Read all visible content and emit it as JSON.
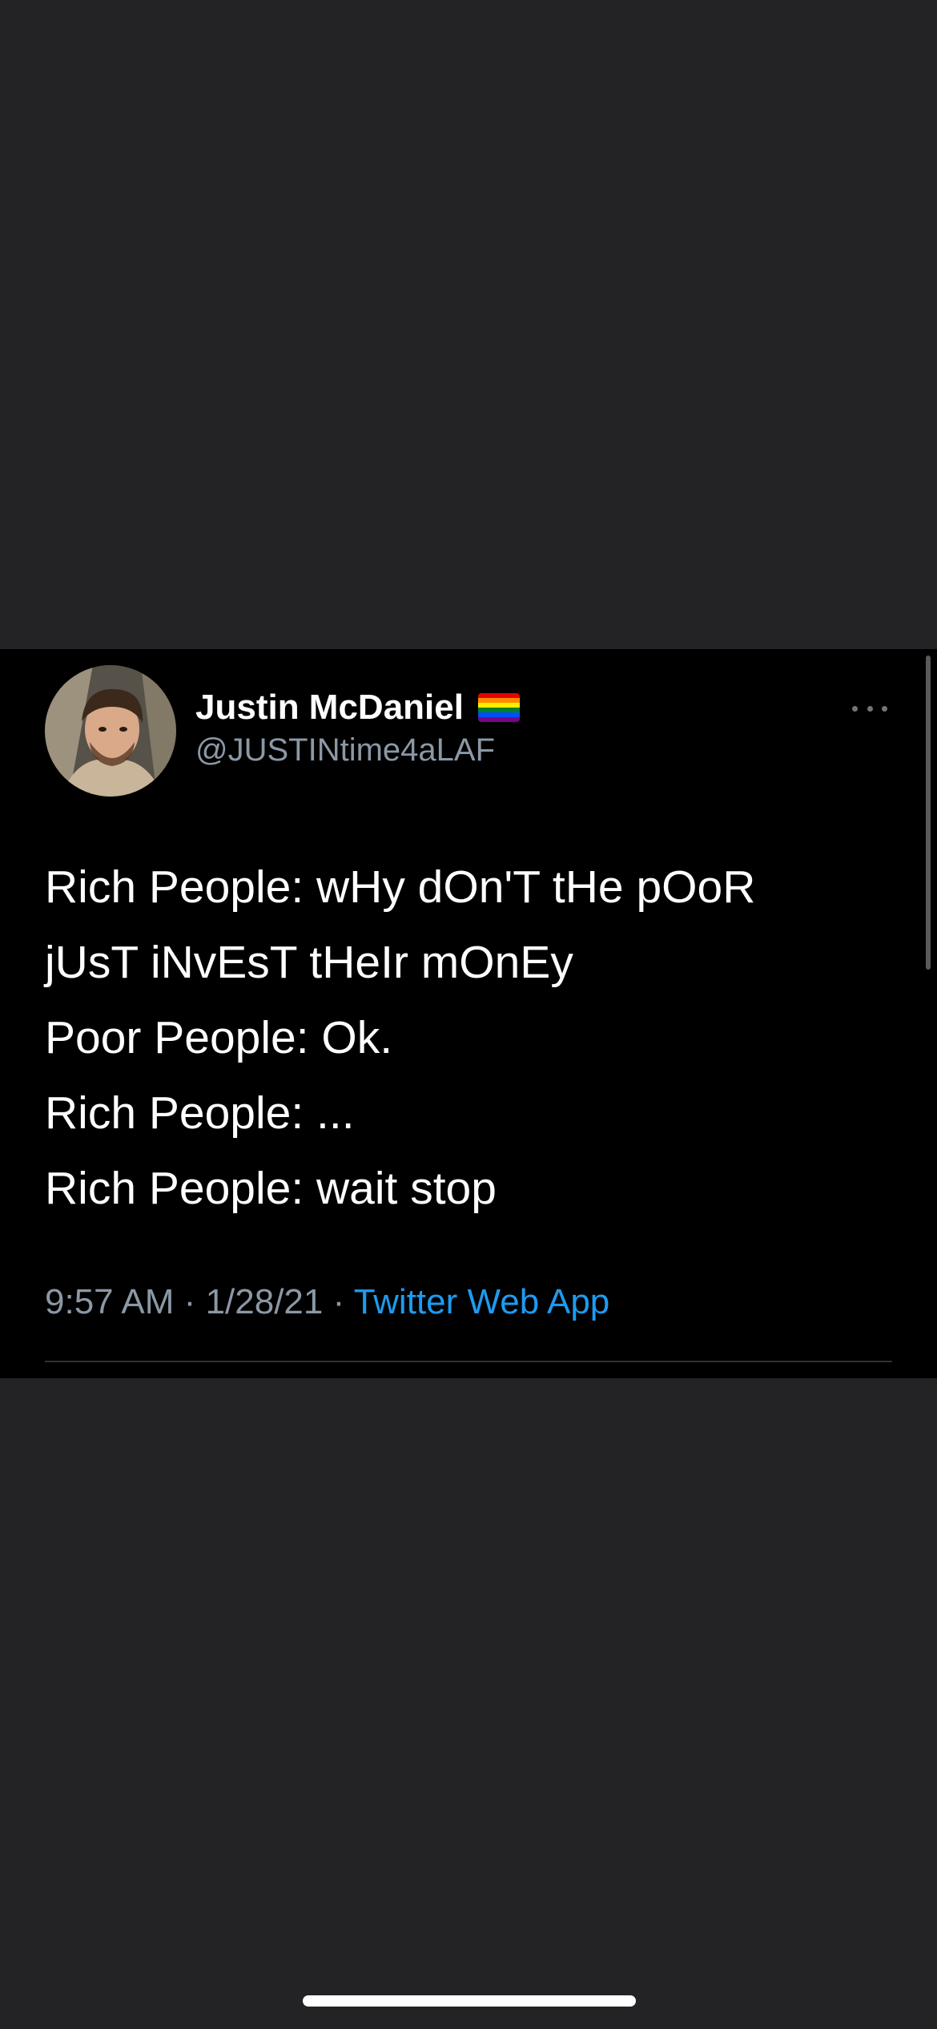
{
  "tweet": {
    "display_name": "Justin McDaniel",
    "handle": "@JUSTINtime4aLAF",
    "flag_icon": "rainbow-flag-icon",
    "more_icon": "more-horizontal-icon",
    "text_lines": [
      "Rich People: wHy dOn'T tHe pOoR",
      "jUsT iNvEsT tHeIr mOnEy",
      "Poor People: Ok.",
      "Rich People: ...",
      "Rich People: wait stop"
    ],
    "time": "9:57 AM",
    "date": "1/28/21",
    "separator": "·",
    "source": "Twitter Web App"
  },
  "colors": {
    "background": "#232325",
    "card": "#000000",
    "text": "#ffffff",
    "secondary": "#8b98a5",
    "link": "#1d9bf0"
  }
}
